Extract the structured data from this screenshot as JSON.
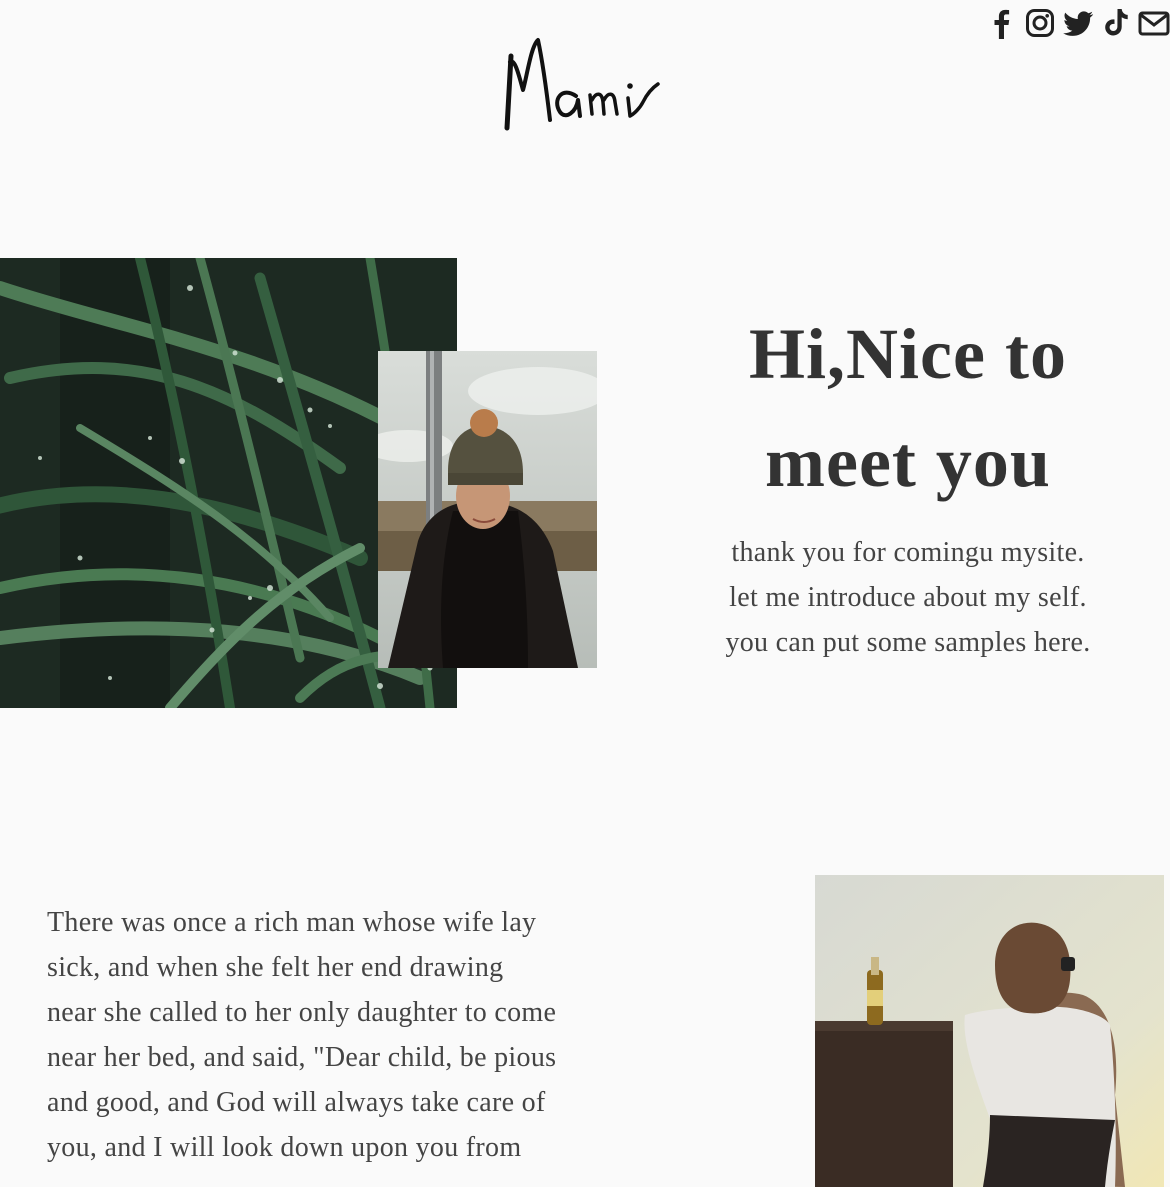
{
  "header": {
    "logo_text": "Mami",
    "social_icons": [
      "facebook-icon",
      "instagram-icon",
      "twitter-icon",
      "tiktok-icon",
      "mail-icon"
    ]
  },
  "intro": {
    "heading_line1": "Hi,Nice to",
    "heading_line2": "meet you",
    "lines": [
      "thank you for comingu mysite.",
      "let me introduce about my self.",
      "you can put some samples here."
    ]
  },
  "story": {
    "text": "There was once a rich man whose wife lay sick, and when she felt her end drawing near she called to her only daughter to come near her bed, and said, \"Dear child, be pious and good, and God will always take care of you, and I will look down upon you from"
  },
  "colors": {
    "background": "#fafafa",
    "text": "#333333",
    "icon": "#222222"
  }
}
